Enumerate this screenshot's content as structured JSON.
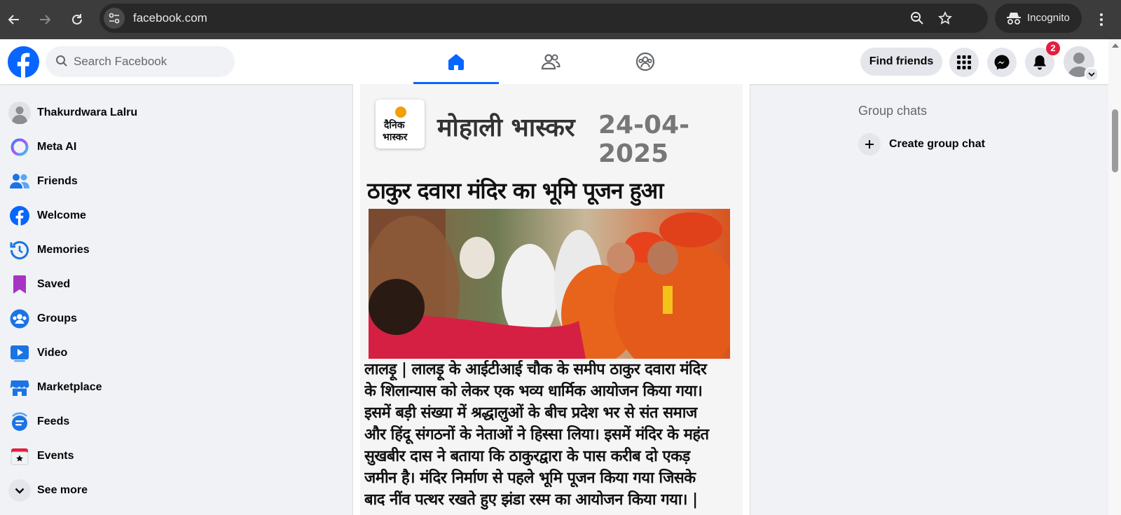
{
  "browser": {
    "url": "facebook.com",
    "profile_label": "Incognito"
  },
  "header": {
    "search_placeholder": "Search Facebook",
    "find_friends_label": "Find friends",
    "notification_count": "2",
    "tabs": [
      {
        "name": "home",
        "active": true
      },
      {
        "name": "friends",
        "active": false
      },
      {
        "name": "groups",
        "active": false
      }
    ]
  },
  "sidebar": {
    "items": [
      {
        "label": "Thakurdwara Lalru",
        "icon": "profile-avatar"
      },
      {
        "label": "Meta AI",
        "icon": "meta-ai-icon"
      },
      {
        "label": "Friends",
        "icon": "friends-icon"
      },
      {
        "label": "Welcome",
        "icon": "facebook-icon"
      },
      {
        "label": "Memories",
        "icon": "memories-icon"
      },
      {
        "label": "Saved",
        "icon": "saved-icon"
      },
      {
        "label": "Groups",
        "icon": "groups-icon"
      },
      {
        "label": "Video",
        "icon": "video-icon"
      },
      {
        "label": "Marketplace",
        "icon": "marketplace-icon"
      },
      {
        "label": "Feeds",
        "icon": "feeds-icon"
      },
      {
        "label": "Events",
        "icon": "events-icon"
      },
      {
        "label": "See more",
        "icon": "chevron-down-icon"
      }
    ]
  },
  "post": {
    "logo_line1": "दैनिक",
    "logo_line2": "भास्कर",
    "masthead": "मोहाली भास्कर",
    "date": "24-04-2025",
    "headline": "ठाकुर दवारा मंदिर का भूमि पूजन हुआ",
    "body_lines": [
      "लालड़ू   | लालड़ू के आईटीआई चौक के समीप ठाकुर दवारा मंदिर",
      "के शिलान्यास को लेकर एक भव्य धार्मिक आयोजन किया गया।",
      "इसमें बड़ी संख्या में श्रद्धालुओं के बीच प्रदेश भर से संत समाज",
      "और हिंदू संगठनों के नेताओं ने हिस्सा लिया। इसमें मंदिर के महंत",
      "सुखबीर दास ने बताया कि ठाकुरद्वारा के पास करीब दो एकड़",
      "जमीन है। मंदिर निर्माण से पहले भूमि पूजन किया गया जिसके",
      "बाद नींव पत्थर रखते हुए झंडा रस्म का आयोजन किया गया। |"
    ]
  },
  "right": {
    "group_chats_title": "Group chats",
    "create_group_chat_label": "Create group chat"
  },
  "colors": {
    "facebook_blue": "#0866ff",
    "badge_red": "#e41e3f",
    "chrome_dark": "#3c3c3c"
  }
}
